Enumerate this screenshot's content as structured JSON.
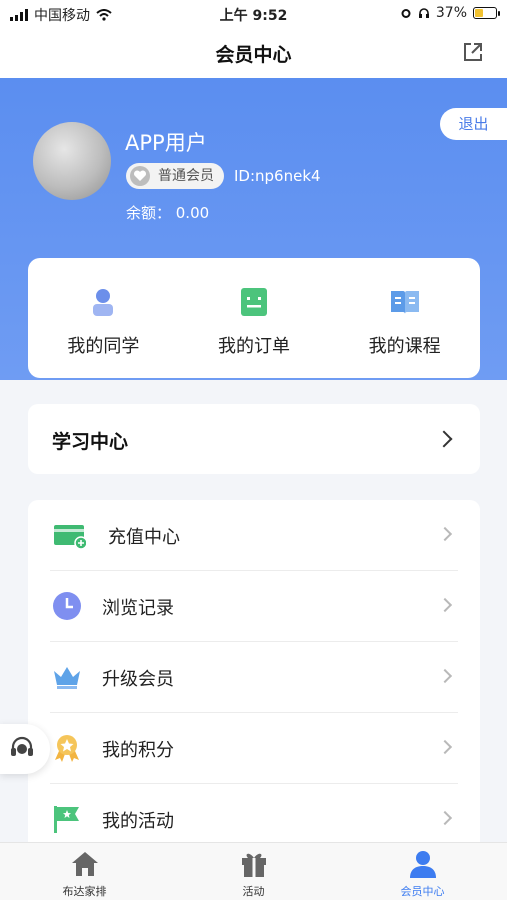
{
  "status_bar": {
    "carrier": "中国移动",
    "time": "上午 9:52",
    "battery": "37%",
    "battery_level": 0.37
  },
  "nav": {
    "title": "会员中心",
    "share_icon": "share-icon"
  },
  "profile": {
    "logout": "退出",
    "name": "APP用户",
    "level": "普通会员",
    "id": "ID:np6nek4",
    "balance": "余额： 0.00"
  },
  "quick": [
    {
      "label": "我的同学",
      "icon": "classmate-icon",
      "color": "#6c8fea"
    },
    {
      "label": "我的订单",
      "icon": "order-icon",
      "color": "#4cc47c"
    },
    {
      "label": "我的课程",
      "icon": "course-icon",
      "color": "#5c9be8"
    }
  ],
  "study": {
    "title": "学习中心"
  },
  "menu": [
    {
      "label": "充值中心",
      "icon": "wallet-icon",
      "color": "#3fba72"
    },
    {
      "label": "浏览记录",
      "icon": "clock-icon",
      "color": "#7f8ff0"
    },
    {
      "label": "升级会员",
      "icon": "crown-icon",
      "color": "#5ea3e8"
    },
    {
      "label": "我的积分",
      "icon": "medal-icon",
      "color": "#f2b440"
    },
    {
      "label": "我的活动",
      "icon": "flag-icon",
      "color": "#4cc47c"
    }
  ],
  "tabs": [
    {
      "label": "布达家排",
      "icon": "home-icon",
      "active": false
    },
    {
      "label": "活动",
      "icon": "gift-icon",
      "active": false
    },
    {
      "label": "会员中心",
      "icon": "user-icon",
      "active": true
    }
  ],
  "colors": {
    "primary": "#5b8ef0",
    "active_tab": "#3d7cf0"
  }
}
